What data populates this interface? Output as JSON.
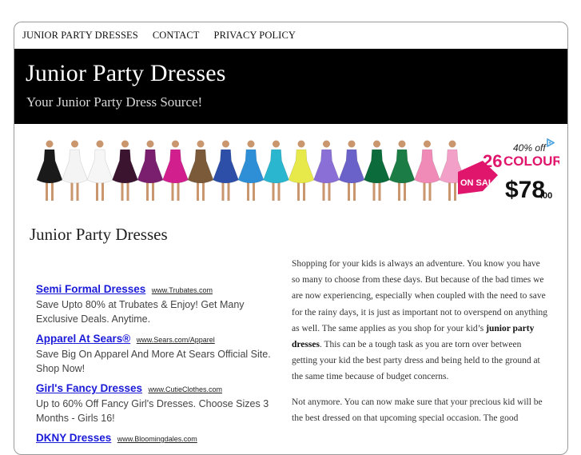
{
  "nav": {
    "items": [
      {
        "label": "JUNIOR PARTY DRESSES"
      },
      {
        "label": "CONTACT"
      },
      {
        "label": "PRIVACY POLICY"
      }
    ]
  },
  "header": {
    "title": "Junior Party Dresses",
    "tagline": "Your Junior Party Dress Source!"
  },
  "banner": {
    "on_sale": "ON SALE",
    "count": "26",
    "discount": "40% off",
    "colour": "COLOUR",
    "price": "$78",
    "price_cents": ".00",
    "icon": "adchoices-icon",
    "dress_colors": [
      "#1a1a1a",
      "#f4f4f4",
      "#f6f6f6",
      "#3b1530",
      "#7a1e6e",
      "#d11f8e",
      "#7b5a3a",
      "#2d4fa8",
      "#2f8fd6",
      "#2ab6cf",
      "#e7e84a",
      "#8a6fd6",
      "#6a62c8",
      "#0c6b3a",
      "#1c7c45",
      "#f08bb8",
      "#f2a0c7"
    ]
  },
  "page_title": "Junior Party Dresses",
  "ads": [
    {
      "title": "Semi Formal Dresses",
      "url": "www.Trubates.com",
      "desc": "Save Upto 80% at Trubates & Enjoy! Get Many Exclusive Deals. Anytime."
    },
    {
      "title": "Apparel At Sears®",
      "url": "www.Sears.com/Apparel",
      "desc": "Save Big On Apparel And More At Sears Official Site. Shop Now!"
    },
    {
      "title": "Girl's Fancy Dresses",
      "url": "www.CutieClothes.com",
      "desc": "Up to 60% Off Fancy Girl's Dresses. Choose Sizes 3 Months - Girls 16!"
    },
    {
      "title": "DKNY Dresses",
      "url": "www.Bloomingdales.com",
      "desc": ""
    }
  ],
  "content": {
    "p1_before": "Shopping for your kids is always an adventure. You know you have so many to choose from these days. But because of the bad times we are now experiencing, especially when coupled with the need to save for the rainy days, it is just as important not to overspend on anything as well. The same applies as you shop for your kid’s ",
    "p1_bold": "junior party dresses",
    "p1_after": ". This can be a tough task as you are torn over between getting your kid the best party dress and being held to the ground at the same time because of budget concerns.",
    "p2": "Not anymore. You can now make sure that your precious kid will be the best dressed on that upcoming special occasion. The good"
  }
}
